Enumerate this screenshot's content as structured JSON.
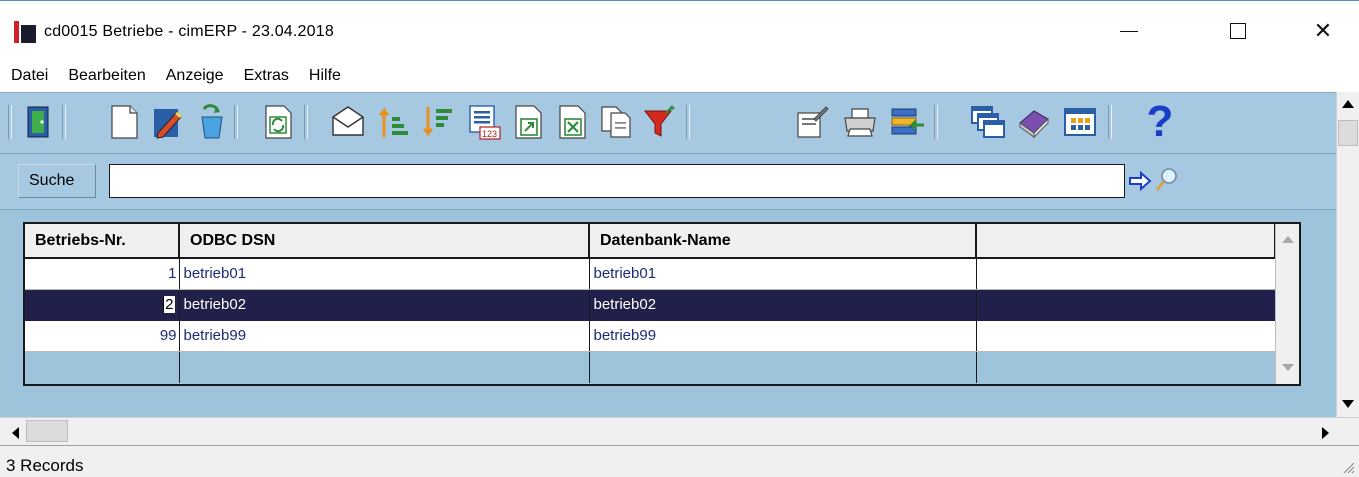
{
  "window": {
    "title": "cd0015 Betriebe - cimERP - 23.04.2018",
    "minimize_glyph": "",
    "close_glyph": "✕"
  },
  "menu": [
    "Datei",
    "Bearbeiten",
    "Anzeige",
    "Extras",
    "Hilfe"
  ],
  "toolbar": {
    "icons": [
      "exit-door-icon",
      "new-document-icon",
      "edit-pencil-icon",
      "copy-recycle-icon",
      "refresh-icon",
      "mail-envelope-icon",
      "sort-ascending-icon",
      "sort-descending-icon",
      "numbered-list-icon",
      "export-document-icon",
      "excel-export-icon",
      "copy-pages-icon",
      "filter-funnel-icon",
      "properties-icon",
      "print-icon",
      "transfer-icon",
      "windows-icon",
      "book-icon",
      "grid-view-icon",
      "help-question-icon"
    ],
    "help_glyph": "?"
  },
  "search": {
    "label": "Suche",
    "value": "",
    "go_icon": "arrow-right-icon",
    "find_icon": "magnifier-icon"
  },
  "grid": {
    "columns": [
      "Betriebs-Nr.",
      "ODBC DSN",
      "Datenbank-Name",
      ""
    ],
    "rows": [
      {
        "nr": "1",
        "dsn": "betrieb01",
        "db": "betrieb01",
        "extra": ""
      },
      {
        "nr": "2",
        "dsn": "betrieb02",
        "db": "betrieb02",
        "extra": ""
      },
      {
        "nr": "99",
        "dsn": "betrieb99",
        "db": "betrieb99",
        "extra": ""
      }
    ],
    "selected_row_index": 1
  },
  "status": {
    "records": "3 Records"
  },
  "colors": {
    "panel": "#a6c8e0",
    "selection": "#20204a",
    "cell_text": "#1e2a78"
  }
}
